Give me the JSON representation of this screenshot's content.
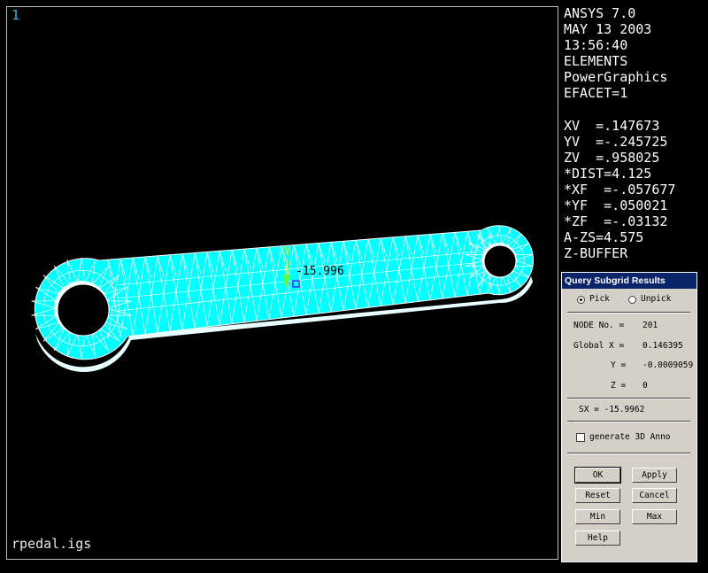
{
  "viewport": {
    "window_number": "1",
    "filename": "rpedal.igs",
    "triad_label": "Y",
    "annotation_value": "-15.996",
    "colors": {
      "mesh_fill": "#00ffff",
      "mesh_edge": "#ffffff",
      "background": "#000000",
      "triad": "#ffff00"
    }
  },
  "info_panel": [
    "ANSYS 7.0",
    "MAY 13 2003",
    "13:56:40",
    "ELEMENTS",
    "PowerGraphics",
    "EFACET=1",
    "",
    "XV  =.147673",
    "YV  =-.245725",
    "ZV  =.958025",
    "*DIST=4.125",
    "*XF  =-.057677",
    "*YF  =.050021",
    "*ZF  =-.03132",
    "A-ZS=4.575",
    "Z-BUFFER"
  ],
  "dialog": {
    "title": "Query Subgrid Results",
    "pick_label": "Pick",
    "unpick_label": "Unpick",
    "node_label": "NODE No. =",
    "node_value": "201",
    "global_x_label": "Global X =",
    "global_x_value": "0.146395",
    "y_label": "Y =",
    "y_value": "-0.0009059",
    "z_label": "Z =",
    "z_value": "0",
    "result_text": "SX = -15.9962",
    "generate_anno_label": "generate 3D Anno",
    "buttons": {
      "ok": "OK",
      "apply": "Apply",
      "reset": "Reset",
      "cancel": "Cancel",
      "min": "Min",
      "max": "Max",
      "help": "Help"
    }
  }
}
